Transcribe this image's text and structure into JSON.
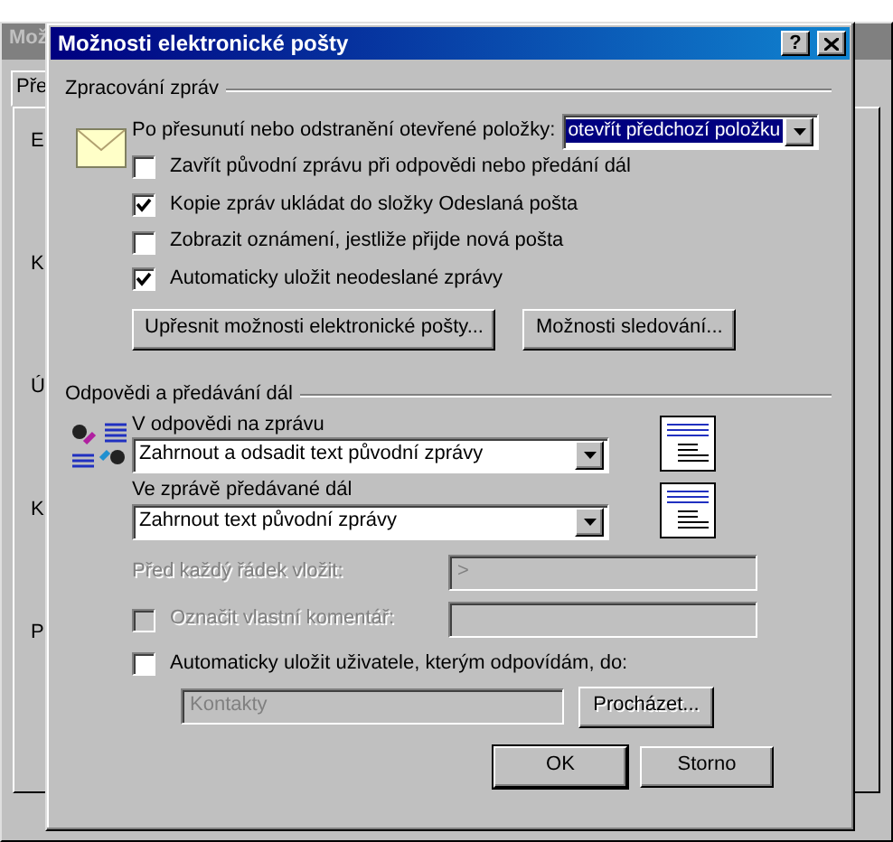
{
  "background_window": {
    "title": "Mož",
    "tab": "Pře",
    "labels": [
      "E",
      "K",
      "Ú",
      "K",
      "P"
    ]
  },
  "dialog": {
    "title": "Možnosti elektronické pošty",
    "help_button": "?",
    "processing": {
      "title": "Zpracování zpráv",
      "after_move": {
        "label": "Po přesunutí nebo odstranění otevřené položky:",
        "value": "otevřít předchozí položku"
      },
      "options": [
        {
          "label": "Zavřít původní zprávu při odpovědi nebo předání dál",
          "checked": false
        },
        {
          "label": "Kopie zpráv ukládat do složky Odeslaná pošta",
          "checked": true
        },
        {
          "label": "Zobrazit oznámení, jestliže přijde nová pošta",
          "checked": false
        },
        {
          "label": "Automaticky uložit neodeslané zprávy",
          "checked": true
        }
      ],
      "buttons": [
        "Upřesnit možnosti elektronické pošty...",
        "Možnosti sledování..."
      ]
    },
    "replies": {
      "title": "Odpovědi a předávání dál",
      "reply": {
        "label": "V odpovědi na zprávu",
        "value": "Zahrnout a odsadit text původní zprávy"
      },
      "forward": {
        "label": "Ve zprávě předávané dál",
        "value": "Zahrnout text původní zprávy"
      },
      "prefix": {
        "label": "Před každý řádek vložit:",
        "value": ">",
        "disabled": true
      },
      "mark_comments": {
        "label": "Označit vlastní komentář:",
        "checked": false,
        "disabled": true
      },
      "save_contacts": {
        "label": "Automaticky uložit uživatele, kterým odpovídám, do:",
        "checked": false,
        "disabled": false
      },
      "contacts_folder": {
        "value": "Kontakty",
        "disabled": true
      },
      "browse_button": {
        "label": "Procházet...",
        "disabled": true
      }
    },
    "footer_buttons": [
      {
        "label": "OK",
        "default": true
      },
      {
        "label": "Storno",
        "default": false
      }
    ]
  }
}
